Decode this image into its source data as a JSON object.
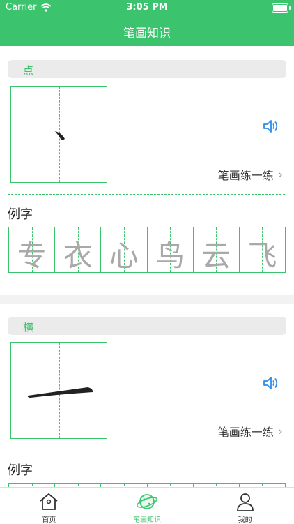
{
  "status_bar": {
    "carrier": "Carrier",
    "time": "3:05 PM"
  },
  "header": {
    "title": "笔画知识"
  },
  "strokes": [
    {
      "name": "点",
      "practice_label": "笔画练一练",
      "examples_label": "例字",
      "examples": [
        "专",
        "衣",
        "心",
        "鸟",
        "云",
        "飞"
      ]
    },
    {
      "name": "横",
      "practice_label": "笔画练一练",
      "examples_label": "例字",
      "examples": []
    }
  ],
  "tabs": [
    {
      "label": "首页",
      "icon": "home-icon",
      "active": false
    },
    {
      "label": "笔画知识",
      "icon": "planet-icon",
      "active": true
    },
    {
      "label": "我的",
      "icon": "person-icon",
      "active": false
    }
  ],
  "colors": {
    "accent": "#3cc36d",
    "speaker": "#2f8be6"
  }
}
